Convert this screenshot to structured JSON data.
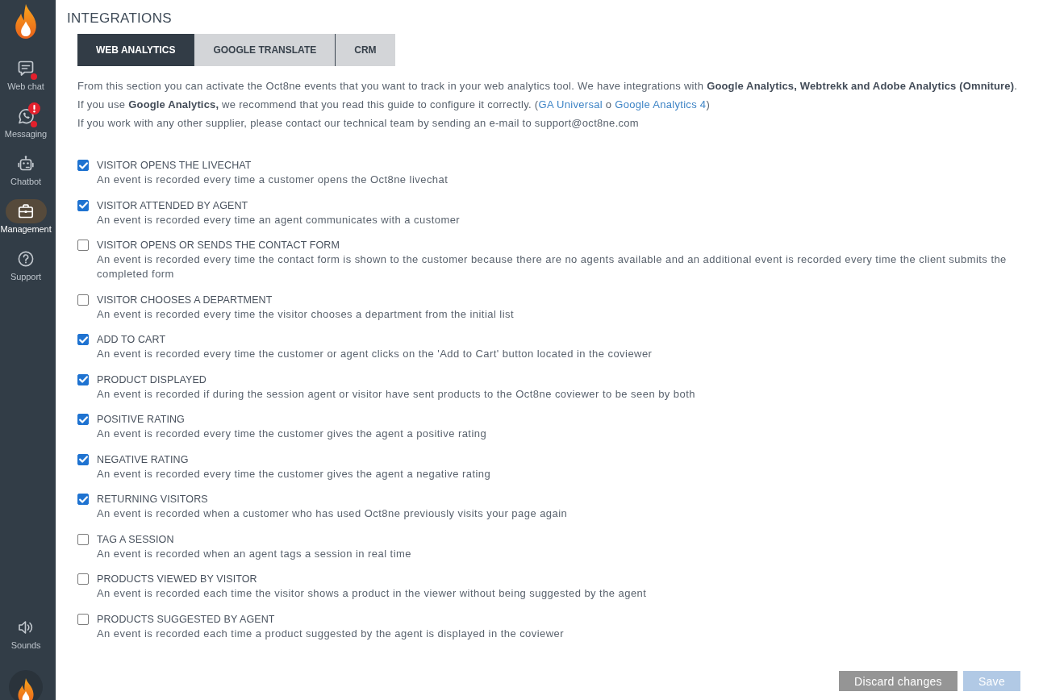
{
  "sidebar": {
    "items": [
      {
        "label": "Web chat",
        "selected": false,
        "unread": true,
        "alert": false
      },
      {
        "label": "Messaging",
        "selected": false,
        "unread": true,
        "alert": true
      },
      {
        "label": "Chatbot",
        "selected": false,
        "unread": false,
        "alert": false
      },
      {
        "label": "Management",
        "selected": true,
        "unread": false,
        "alert": false
      },
      {
        "label": "Support",
        "selected": false,
        "unread": false,
        "alert": false
      }
    ],
    "footer_items": [
      {
        "label": "Sounds",
        "selected": false
      }
    ]
  },
  "page": {
    "title": "INTEGRATIONS",
    "tabs": [
      {
        "label": "WEB ANALYTICS",
        "selected": true
      },
      {
        "label": "GOOGLE TRANSLATE",
        "selected": false
      },
      {
        "label": "CRM",
        "selected": false
      }
    ],
    "intro": [
      {
        "parts": [
          {
            "kind": "text",
            "text": "From this section you can activate the Oct8ne events that you want to track in your web analytics tool. We have integrations with **Google Analytics, Webtrekk and Adobe Analytics (Omniture)**."
          }
        ]
      },
      {
        "parts": [
          {
            "kind": "text",
            "text": "If you use **Google Analytics,** we recommend that you read this guide to configure it correctly. ("
          },
          {
            "kind": "link",
            "text": "GA Universal"
          },
          {
            "kind": "text",
            "text": " o "
          },
          {
            "kind": "link",
            "text": "Google Analytics 4"
          },
          {
            "kind": "text",
            "text": ")"
          }
        ]
      },
      {
        "parts": [
          {
            "kind": "text",
            "text": "If you work with any other supplier, please contact our technical team by sending an e-mail to support@oct8ne.com"
          }
        ]
      }
    ],
    "events": [
      {
        "title": "VISITOR OPENS THE LIVECHAT",
        "description": "An event is recorded every time a customer opens the Oct8ne livechat",
        "checked": true
      },
      {
        "title": "VISITOR ATTENDED BY AGENT",
        "description": "An event is recorded every time an agent communicates with a customer",
        "checked": true
      },
      {
        "title": "VISITOR OPENS OR SENDS THE CONTACT FORM",
        "description": "An event is recorded every time the contact form is shown to the customer because there are no agents available and an additional event is recorded every time the client submits the completed form",
        "checked": false
      },
      {
        "title": "VISITOR CHOOSES A DEPARTMENT",
        "description": "An event is recorded every time the visitor chooses a department from the initial list",
        "checked": false
      },
      {
        "title": "ADD TO CART",
        "description": "An event is recorded every time the customer or agent clicks on the 'Add to Cart' button located in the coviewer",
        "checked": true
      },
      {
        "title": "PRODUCT DISPLAYED",
        "description": "An event is recorded if during the session agent or visitor have sent products to the Oct8ne coviewer to be seen by both",
        "checked": true
      },
      {
        "title": "POSITIVE RATING",
        "description": "An event is recorded every time the customer gives the agent a positive rating",
        "checked": true
      },
      {
        "title": "NEGATIVE RATING",
        "description": "An event is recorded every time the customer gives the agent a negative rating",
        "checked": true
      },
      {
        "title": "RETURNING VISITORS",
        "description": "An event is recorded when a customer who has used Oct8ne previously visits your page again",
        "checked": true
      },
      {
        "title": "TAG A SESSION",
        "description": "An event is recorded when an agent tags a session in real time",
        "checked": false
      },
      {
        "title": "PRODUCTS VIEWED BY VISITOR",
        "description": "An event is recorded each time the visitor shows a product in the viewer without being suggested by the agent",
        "checked": false
      },
      {
        "title": "PRODUCTS SUGGESTED BY AGENT",
        "description": "An event is recorded each time a product suggested by the agent is displayed in the coviewer",
        "checked": false
      }
    ],
    "buttons": [
      {
        "label": "Discard changes",
        "kind": "secondary",
        "disabled": false
      },
      {
        "label": "Save",
        "kind": "primary",
        "disabled": true
      }
    ]
  }
}
